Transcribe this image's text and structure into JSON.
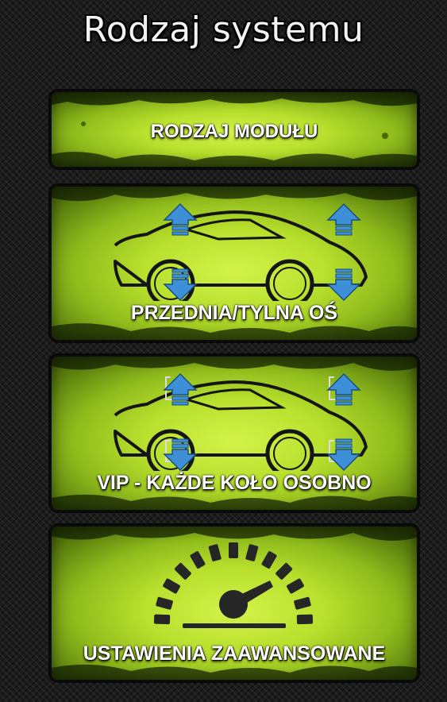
{
  "header": {
    "title": "Rodzaj systemu"
  },
  "menu": {
    "module_type_label": "RODZAJ MODUŁU",
    "axle_label": "PRZEDNIA/TYLNA OŚ",
    "vip_label": "VIP - KAŻDE KOŁO OSOBNO",
    "advanced_label": "USTAWIENIA ZAAWANSOWANE"
  },
  "colors": {
    "panel_center": "#d4f34a",
    "panel_edge": "#3d5708",
    "arrow_blue": "#3d8fd8",
    "background": "#1c1c1c"
  },
  "icons": {
    "axle": "car-axle-icon",
    "vip": "car-four-wheel-icon",
    "advanced": "gauge-icon"
  }
}
